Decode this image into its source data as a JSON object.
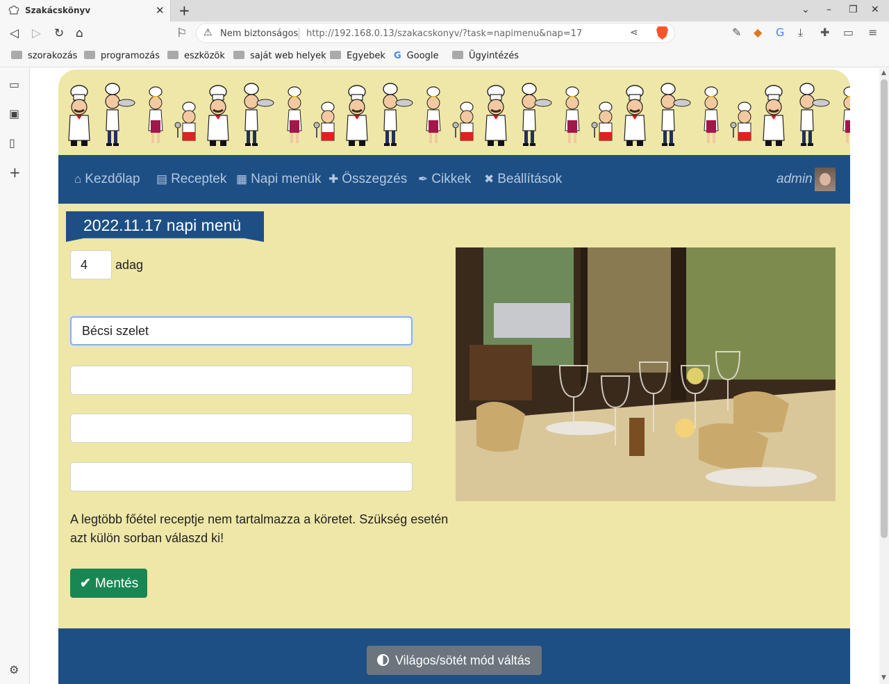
{
  "browser": {
    "tab_title": "Szakácskönyv",
    "tab_close": "✕",
    "new_tab": "+",
    "security_label": "Nem biztonságos",
    "url": "http://192.168.0.13/szakacskonyv/?task=napimenu&nap=17",
    "bookmarks": [
      "szorakozás",
      "programozás",
      "eszközök",
      "saját web helyek",
      "Egyebek",
      "Google",
      "Ügyintézés"
    ]
  },
  "nav": {
    "items": [
      {
        "label": "Kezdőlap",
        "icon": "home-icon"
      },
      {
        "label": "Receptek",
        "icon": "book-icon"
      },
      {
        "label": "Napi menük",
        "icon": "calendar-icon"
      },
      {
        "label": "Összegzés",
        "icon": "plus-icon"
      },
      {
        "label": "Cikkek",
        "icon": "feather-icon"
      },
      {
        "label": "Beállítások",
        "icon": "tools-icon"
      }
    ],
    "user": "admin"
  },
  "page": {
    "title": "2022.11.17 napi menü",
    "portions_value": "4",
    "portions_unit": "adag",
    "dishes": [
      "Bécsi szelet",
      "",
      "",
      ""
    ],
    "note": "A legtöbb főétel receptje nem tartalmazza a köretet. Szükség esetén azt külön sorban válaszd ki!",
    "save_label": "Mentés",
    "mode_toggle_label": "Világos/sötét mód váltás"
  },
  "colors": {
    "page_bg": "#efe7a7",
    "nav_bg": "#1d4f85",
    "save_green": "#198754",
    "mode_gray": "#6c757d"
  }
}
